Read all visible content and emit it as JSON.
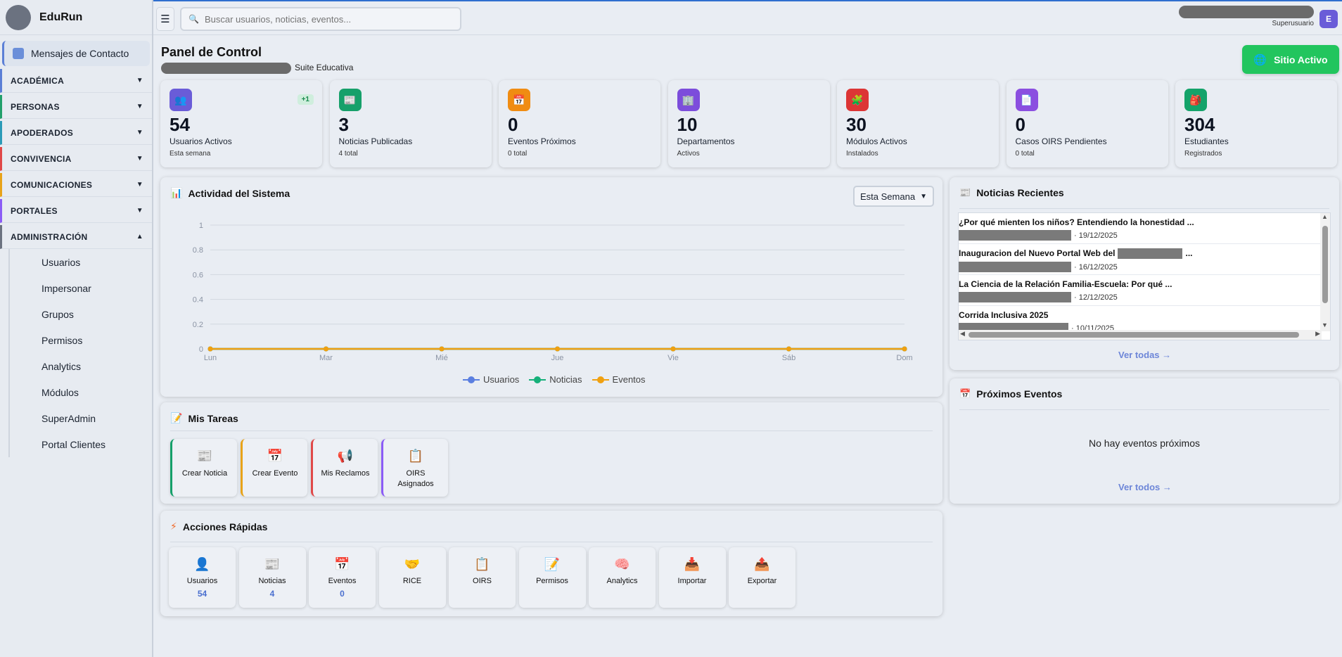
{
  "app": {
    "name": "EduRun"
  },
  "search": {
    "placeholder": "Buscar usuarios, noticias, eventos..."
  },
  "user": {
    "role": "Superusuario",
    "initial": "E"
  },
  "sidebar": {
    "contact": "Mensajes de Contacto",
    "groups": [
      {
        "label": "ACADÉMICA",
        "color": "#5b7fd6"
      },
      {
        "label": "PERSONAS",
        "color": "#22a06b"
      },
      {
        "label": "APODERADOS",
        "color": "#2b9bb8"
      },
      {
        "label": "CONVIVENCIA",
        "color": "#e04848"
      },
      {
        "label": "COMUNICACIONES",
        "color": "#e8a319"
      },
      {
        "label": "PORTALES",
        "color": "#8b5cf6"
      },
      {
        "label": "ADMINISTRACIÓN",
        "color": "#6b7280"
      }
    ],
    "admin_items": [
      "Usuarios",
      "Impersonar",
      "Grupos",
      "Permisos",
      "Analytics",
      "Módulos",
      "SuperAdmin",
      "Portal Clientes"
    ]
  },
  "header": {
    "title": "Panel de Control",
    "subtitle": "Suite Educativa",
    "site_button": "Sitio Activo"
  },
  "stats": [
    {
      "value": "54",
      "label": "Usuarios Activos",
      "sub": "Esta semana",
      "badge": "+1",
      "color": "#6a5cd8",
      "icon": "users-icon"
    },
    {
      "value": "3",
      "label": "Noticias Publicadas",
      "sub": "4 total",
      "color": "#16a06a",
      "icon": "newspaper-icon"
    },
    {
      "value": "0",
      "label": "Eventos Próximos",
      "sub": "0 total",
      "color": "#f08c12",
      "icon": "calendar-icon"
    },
    {
      "value": "10",
      "label": "Departamentos",
      "sub": "Activos",
      "color": "#7c4ddb",
      "icon": "building-icon"
    },
    {
      "value": "30",
      "label": "Módulos Activos",
      "sub": "Instalados",
      "color": "#dc3535",
      "icon": "puzzle-icon"
    },
    {
      "value": "0",
      "label": "Casos OIRS Pendientes",
      "sub": "0 total",
      "color": "#8b4fe0",
      "icon": "document-icon"
    },
    {
      "value": "304",
      "label": "Estudiantes",
      "sub": "Registrados",
      "color": "#14a36a",
      "icon": "student-icon"
    }
  ],
  "activity": {
    "title": "Actividad del Sistema",
    "range": "Esta Semana"
  },
  "chart_data": {
    "type": "line",
    "categories": [
      "Lun",
      "Mar",
      "Mié",
      "Jue",
      "Vie",
      "Sáb",
      "Dom"
    ],
    "series": [
      {
        "name": "Usuarios",
        "values": [
          0,
          0,
          0,
          0,
          0,
          0,
          0
        ],
        "color": "#5b7fe0"
      },
      {
        "name": "Noticias",
        "values": [
          0,
          0,
          0,
          0,
          0,
          0,
          0
        ],
        "color": "#16b07a"
      },
      {
        "name": "Eventos",
        "values": [
          0,
          0,
          0,
          0,
          0,
          0,
          0
        ],
        "color": "#f0a010"
      }
    ],
    "yticks": [
      "0",
      "0.2",
      "0.4",
      "0.6",
      "0.8",
      "1"
    ],
    "ylim": [
      0,
      1
    ],
    "grid": true,
    "legend": "bottom"
  },
  "tasks": {
    "title": "Mis Tareas",
    "items": [
      {
        "label": "Crear Noticia",
        "color": "#16a06a",
        "icon": "newspaper-icon"
      },
      {
        "label": "Crear Evento",
        "color": "#e8a319",
        "icon": "calendar-icon"
      },
      {
        "label": "Mis Reclamos",
        "color": "#e04848",
        "icon": "megaphone-icon"
      },
      {
        "label": "OIRS Asignados",
        "color": "#8b5cf6",
        "icon": "clipboard-icon"
      }
    ]
  },
  "quick": {
    "title": "Acciones Rápidas",
    "items": [
      {
        "label": "Usuarios",
        "count": "54",
        "icon": "user-icon"
      },
      {
        "label": "Noticias",
        "count": "4",
        "icon": "newspaper-icon"
      },
      {
        "label": "Eventos",
        "count": "0",
        "icon": "calendar-icon"
      },
      {
        "label": "RICE",
        "count": "",
        "icon": "handshake-icon"
      },
      {
        "label": "OIRS",
        "count": "",
        "icon": "clipboard-icon"
      },
      {
        "label": "Permisos",
        "count": "",
        "icon": "memo-icon"
      },
      {
        "label": "Analytics",
        "count": "",
        "icon": "brain-icon"
      },
      {
        "label": "Importar",
        "count": "",
        "icon": "inbox-icon"
      },
      {
        "label": "Exportar",
        "count": "",
        "icon": "outbox-icon"
      }
    ]
  },
  "news": {
    "title": "Noticias Recientes",
    "items": [
      {
        "title": "¿Por qué mienten los niños? Entendiendo la honestidad ...",
        "date": "· 19/12/2025"
      },
      {
        "title": "Inauguracion del Nuevo Portal Web del",
        "title_end": "...",
        "date": "· 16/12/2025"
      },
      {
        "title": "La Ciencia de la Relación Familia-Escuela: Por qué ...",
        "date": "· 12/12/2025"
      },
      {
        "title": "Corrida Inclusiva 2025",
        "date": "· 10/11/2025"
      }
    ],
    "link": "Ver todas →"
  },
  "events": {
    "title": "Próximos Eventos",
    "empty": "No hay eventos próximos",
    "link": "Ver todos →"
  }
}
